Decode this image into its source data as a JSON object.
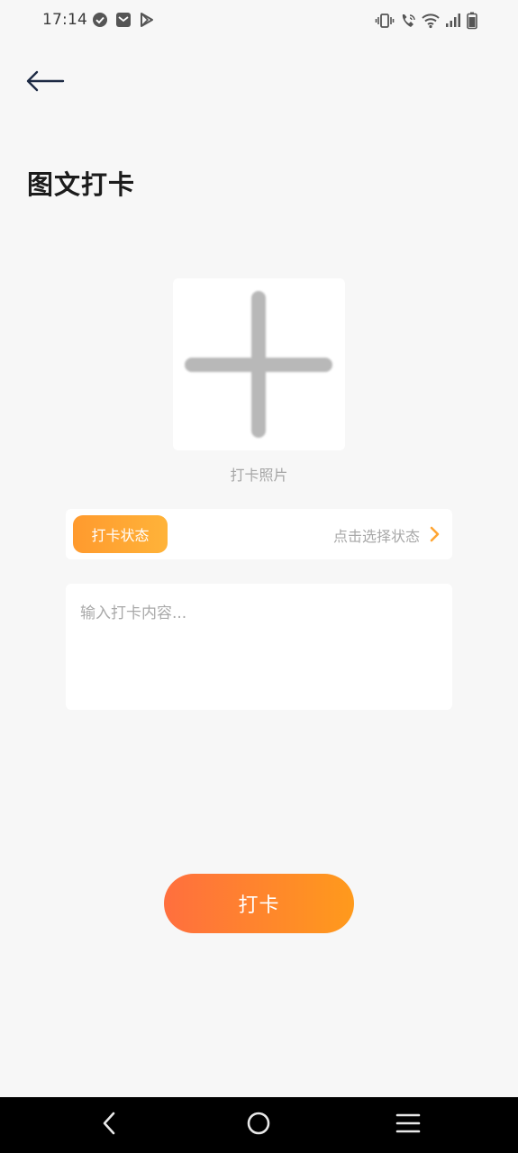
{
  "status_bar": {
    "time": "17:14"
  },
  "header": {
    "title": "图文打卡",
    "back_icon": "arrow-left-icon"
  },
  "photo": {
    "add_icon": "plus-icon",
    "label": "打卡照片"
  },
  "status_select": {
    "tag_label": "打卡状态",
    "hint": "点击选择状态",
    "hint_icon": "chevron-right-icon",
    "accent": "#ffa533"
  },
  "content": {
    "placeholder": "输入打卡内容...",
    "value": ""
  },
  "submit": {
    "label": "打卡",
    "gradient_start": "#ff6f3e",
    "gradient_end": "#ff9a1c"
  },
  "nav": {
    "back_icon": "nav-back-icon",
    "home_icon": "nav-home-icon",
    "menu_icon": "nav-menu-icon"
  }
}
